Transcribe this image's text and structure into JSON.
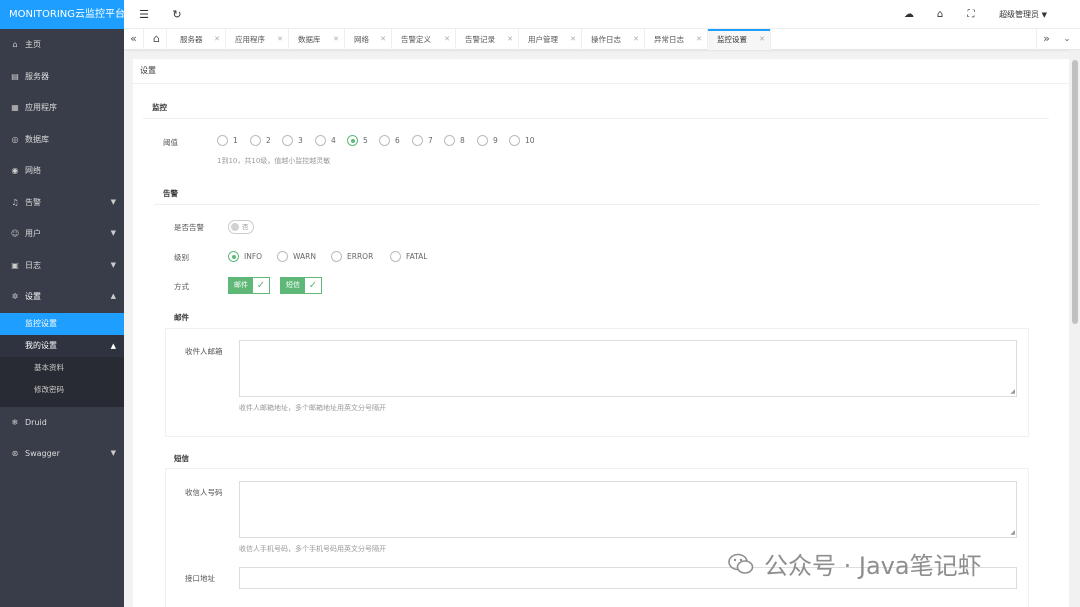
{
  "app": {
    "title": "MONITORING云监控平台"
  },
  "sidebar": {
    "items": [
      {
        "label": "主页",
        "icon": "home-icon"
      },
      {
        "label": "服务器",
        "icon": "server-icon"
      },
      {
        "label": "应用程序",
        "icon": "app-icon"
      },
      {
        "label": "数据库",
        "icon": "database-icon"
      },
      {
        "label": "网络",
        "icon": "network-icon"
      },
      {
        "label": "告警",
        "icon": "bell-icon"
      },
      {
        "label": "用户",
        "icon": "user-icon"
      },
      {
        "label": "日志",
        "icon": "log-icon"
      },
      {
        "label": "设置",
        "icon": "gear-icon"
      }
    ],
    "settings_children": {
      "active": "监控设置",
      "my_settings": "我的设置",
      "profile": "基本资料",
      "password": "修改密码"
    },
    "bottom_items": [
      {
        "label": "Druid",
        "icon": "druid-icon"
      },
      {
        "label": "Swagger",
        "icon": "swagger-icon"
      }
    ]
  },
  "header": {
    "user": "超级管理员"
  },
  "tabs": [
    {
      "label": "服务器"
    },
    {
      "label": "应用程序"
    },
    {
      "label": "数据库"
    },
    {
      "label": "网络"
    },
    {
      "label": "告警定义"
    },
    {
      "label": "告警记录"
    },
    {
      "label": "用户管理"
    },
    {
      "label": "操作日志"
    },
    {
      "label": "异常日志"
    },
    {
      "label": "监控设置",
      "active": true
    }
  ],
  "content": {
    "card_title": "设置",
    "monitor": {
      "title": "监控",
      "threshold_label": "阈值",
      "options": [
        "1",
        "2",
        "3",
        "4",
        "5",
        "6",
        "7",
        "8",
        "9",
        "10"
      ],
      "selected": "5",
      "hint": "1到10，共10级，值越小监控越灵敏"
    },
    "alarm": {
      "title": "告警",
      "enable_label": "是否告警",
      "enable_value": "否",
      "level_label": "级别",
      "levels": [
        "INFO",
        "WARN",
        "ERROR",
        "FATAL"
      ],
      "selected_level": "INFO",
      "method_label": "方式",
      "methods": [
        "邮件",
        "短信"
      ]
    },
    "mail": {
      "title": "邮件",
      "recipient_label": "收件人邮箱",
      "hint": "收件人邮箱地址，多个邮箱地址用英文分号隔开"
    },
    "sms": {
      "title": "短信",
      "recipient_label": "收信人号码",
      "hint": "收信人手机号码，多个手机号码用英文分号隔开",
      "api_label": "接口地址"
    }
  },
  "watermark": "公众号 · Java笔记虾",
  "colors": {
    "brand": "#1e9fff",
    "sidebar": "#393d49",
    "check": "#5fb878"
  }
}
